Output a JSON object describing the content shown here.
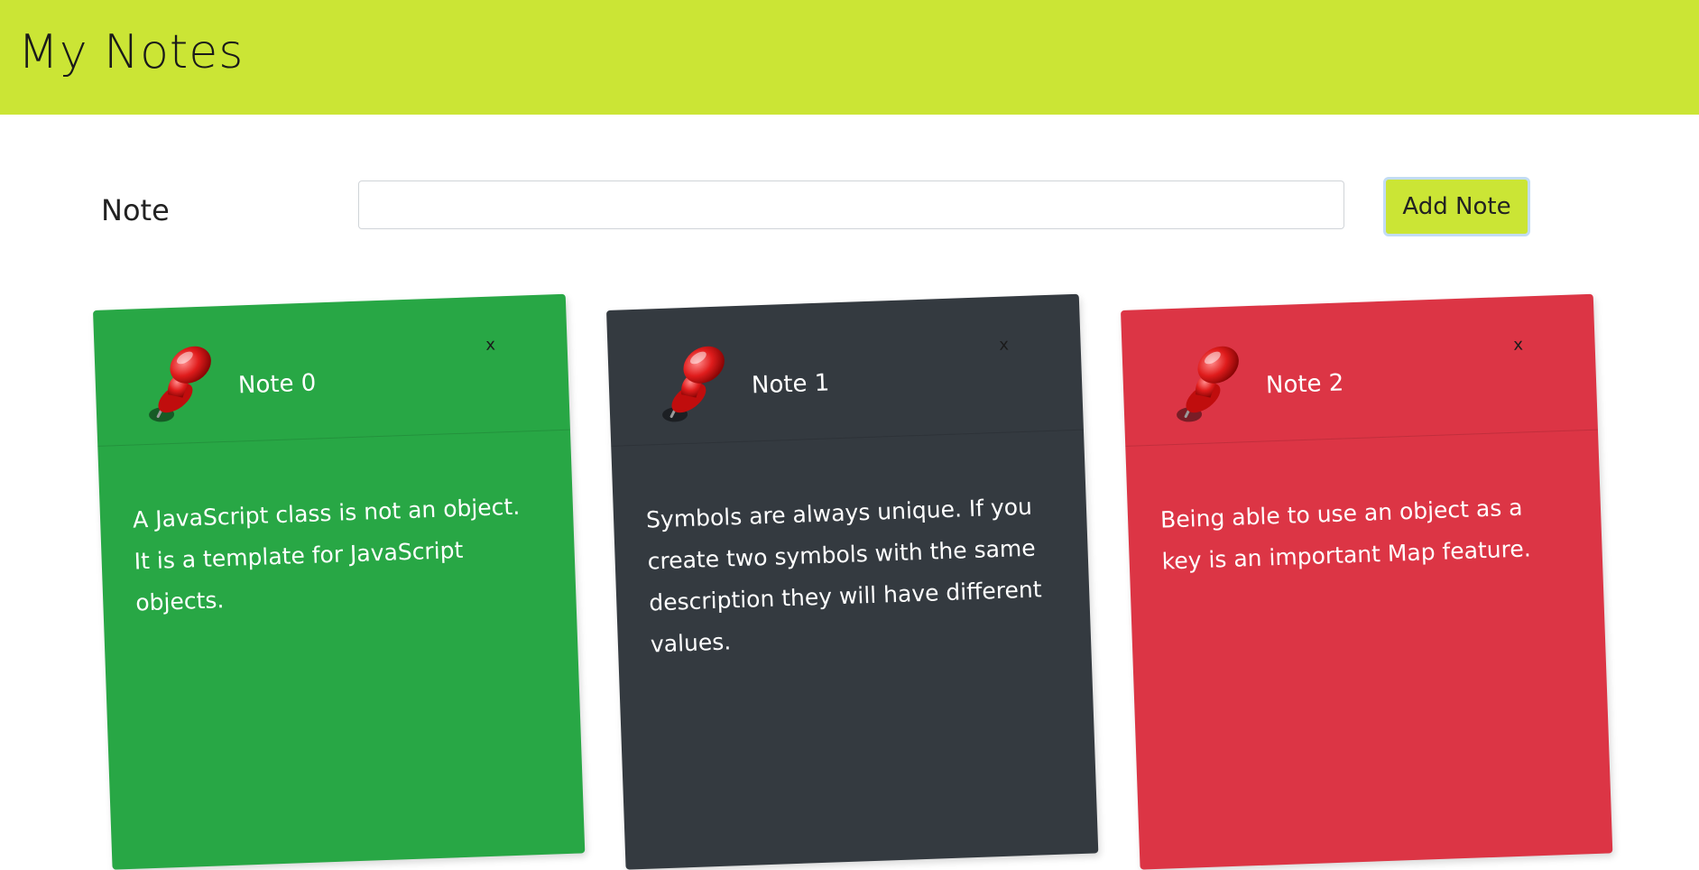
{
  "header": {
    "title": "My Notes",
    "background": "#cbe535"
  },
  "form": {
    "label": "Note",
    "input_value": "",
    "input_placeholder": "",
    "add_button_label": "Add Note"
  },
  "notes": [
    {
      "title": "Note 0",
      "text": "A JavaScript class is not an object. It is a template for JavaScript objects.",
      "color": "#28a745",
      "close_label": "x",
      "icon": "pushpin-icon"
    },
    {
      "title": "Note 1",
      "text": "Symbols are always unique. If you create two symbols with the same description they will have different values.",
      "color": "#343a40",
      "close_label": "x",
      "icon": "pushpin-icon"
    },
    {
      "title": "Note 2",
      "text": "Being able to use an object as a key is an important Map feature.",
      "color": "#dc3545",
      "close_label": "x",
      "icon": "pushpin-icon"
    }
  ]
}
